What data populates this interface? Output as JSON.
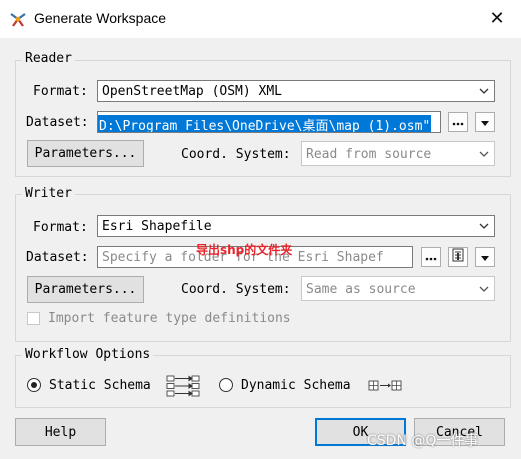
{
  "window": {
    "title": "Generate Workspace",
    "close_label": "✕"
  },
  "reader": {
    "group_label": "Reader",
    "format_label": "Format:",
    "format_value": "OpenStreetMap (OSM) XML",
    "dataset_label": "Dataset:",
    "dataset_value": "D:\\Program Files\\OneDrive\\桌面\\map (1).osm\"",
    "parameters_label": "Parameters...",
    "coord_label": "Coord. System:",
    "coord_value": "Read from source"
  },
  "writer": {
    "group_label": "Writer",
    "format_label": "Format:",
    "format_value": "Esri Shapefile",
    "dataset_label": "Dataset:",
    "dataset_placeholder": "Specify a folder for the Esri Shapef",
    "annotation": "导出shp的文件夹",
    "parameters_label": "Parameters...",
    "coord_label": "Coord. System:",
    "coord_value": "Same as source",
    "import_label": "Import feature type definitions"
  },
  "workflow": {
    "group_label": "Workflow Options",
    "static_label": "Static Schema",
    "dynamic_label": "Dynamic Schema",
    "selected": "Static Schema"
  },
  "footer": {
    "help_label": "Help",
    "ok_label": "OK",
    "cancel_label": "Cancel",
    "watermark": "CSDN @Q一件事"
  },
  "icons": {
    "app": "fme-workbench-icon",
    "ellipsis": "ellipsis-icon",
    "dropdown": "dropdown-arrow-icon",
    "static_schema": "static-schema-icon",
    "dynamic_schema": "dynamic-schema-icon"
  },
  "colors": {
    "selection": "#0078d7",
    "annotation": "#e8232a",
    "default_button_border": "#0078d7"
  }
}
